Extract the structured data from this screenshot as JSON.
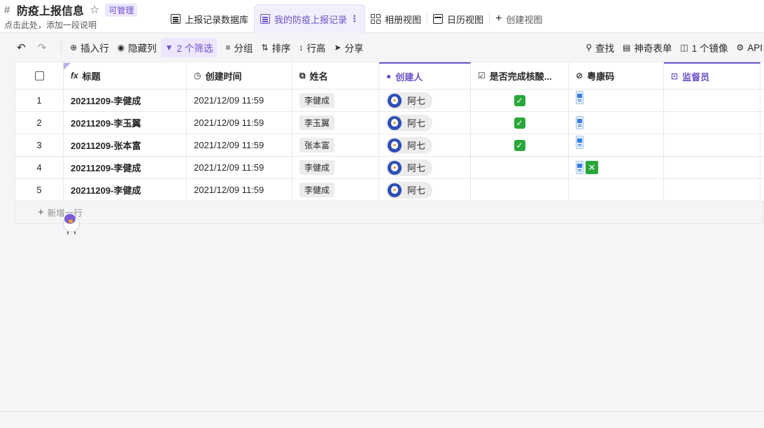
{
  "header": {
    "title": "防疫上报信息",
    "badge": "可管理",
    "description": "点击此处，添加一段说明"
  },
  "tabs": [
    {
      "label": "上报记录数据库",
      "icon": "list-icon"
    },
    {
      "label": "我的防疫上报记录",
      "icon": "list-icon",
      "active": true
    },
    {
      "label": "相册视图",
      "icon": "gallery-icon"
    },
    {
      "label": "日历视图",
      "icon": "calendar-icon"
    },
    {
      "label": "创建视图",
      "icon": "plus-icon"
    }
  ],
  "toolbar": {
    "insert_row": "插入行",
    "hide_columns": "隐藏列",
    "filters": "2 个筛选",
    "group": "分组",
    "sort": "排序",
    "row_height": "行高",
    "share": "分享",
    "find": "查找",
    "magic_form": "神奇表单",
    "mirror": "1 个镜像",
    "api": "API"
  },
  "columns": {
    "title": "标题",
    "created_time": "创建时间",
    "name": "姓名",
    "creator": "创建人",
    "nucleic_done": "是否完成核酸...",
    "health_code": "粤康码",
    "supervisor": "监督员"
  },
  "rows": [
    {
      "num": "1",
      "title": "20211209-李健成",
      "time": "2021/12/09 11:59",
      "name": "李健成",
      "creator": "阿七",
      "done": true,
      "attach": [
        "image"
      ]
    },
    {
      "num": "2",
      "title": "20211209-李玉翼",
      "time": "2021/12/09 11:59",
      "name": "李玉翼",
      "creator": "阿七",
      "done": true,
      "attach": [
        "image"
      ]
    },
    {
      "num": "3",
      "title": "20211209-张本富",
      "time": "2021/12/09 11:59",
      "name": "张本富",
      "creator": "阿七",
      "done": true,
      "attach": [
        "image"
      ]
    },
    {
      "num": "4",
      "title": "20211209-李健成",
      "time": "2021/12/09 11:59",
      "name": "李健成",
      "creator": "阿七",
      "done": false,
      "attach": [
        "image",
        "excel"
      ]
    },
    {
      "num": "5",
      "title": "20211209-李健成",
      "time": "2021/12/09 11:59",
      "name": "李健成",
      "creator": "阿七",
      "done": false,
      "attach": []
    }
  ],
  "add_row": "新增一行",
  "colors": {
    "accent": "#6b52c9",
    "check": "#2aa73a"
  }
}
